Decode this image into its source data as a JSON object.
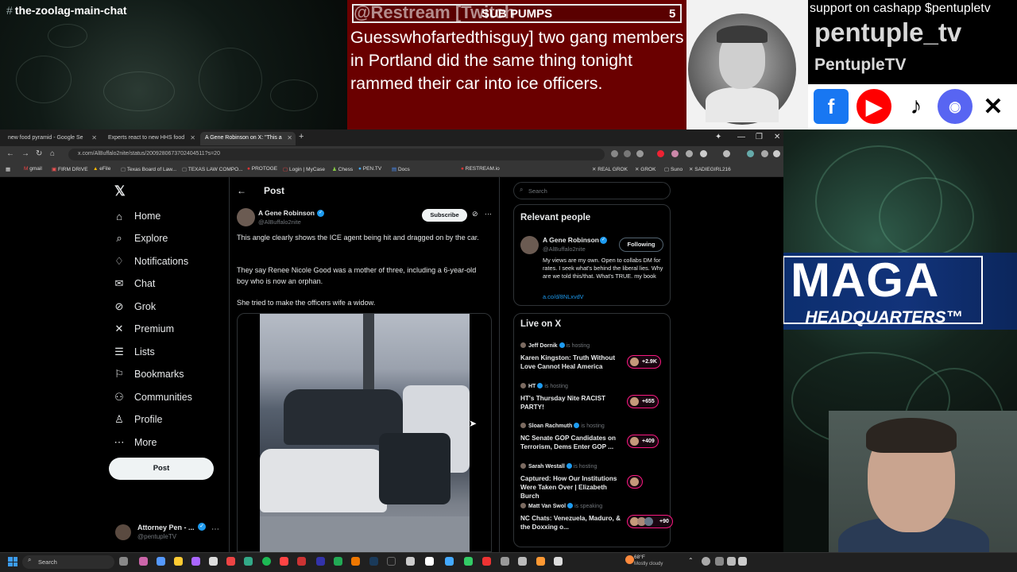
{
  "stream": {
    "chat_title": "the-zoolag-main-chat",
    "alert": {
      "sender": "@Restream [Twitch",
      "tag": "SUB PUMPS",
      "count": "5",
      "message": "Guesswhofartedthisguy] two gang members in Portland did the same thing tonight rammed their car into ice officers."
    },
    "support_text": "support on cashapp $pentupletv",
    "brand_handle": "pentuple_tv",
    "brand_name": "PentupleTV",
    "social_icons": [
      "facebook-icon",
      "youtube-icon",
      "tiktok-icon",
      "discord-icon",
      "x-icon"
    ],
    "banner_title": "MAGA",
    "banner_sub": "HEADQUARTERS™"
  },
  "browser": {
    "tabs": [
      {
        "label": "new food pyramid - Google Se",
        "active": false
      },
      {
        "label": "Experts react to new HHS food",
        "active": false
      },
      {
        "label": "A Gene Robinson on X: \"This a",
        "active": true
      }
    ],
    "url": "x.com/AlBuffalo2nite/status/2009280673702404511?s=20",
    "bookmarks": [
      "gmail",
      "FIRM DRIVE",
      "eFile",
      "Texas Board of Law...",
      "TEXAS LAW COMPO...",
      "PROTOGE",
      "Login | MyCase",
      "Chess",
      "PEN.TV",
      "Docs",
      "RESTREAM.io",
      "REAL GROK",
      "GROK",
      "Suno",
      "SADIEGIRL216"
    ]
  },
  "x": {
    "nav": [
      {
        "label": "Home",
        "icon": "home-icon",
        "glyph": "⌂"
      },
      {
        "label": "Explore",
        "icon": "search-icon",
        "glyph": "⌕"
      },
      {
        "label": "Notifications",
        "icon": "bell-icon",
        "glyph": "♢"
      },
      {
        "label": "Chat",
        "icon": "mail-icon",
        "glyph": "✉"
      },
      {
        "label": "Grok",
        "icon": "grok-icon",
        "glyph": "⊘"
      },
      {
        "label": "Premium",
        "icon": "x-logo-icon",
        "glyph": "✕"
      },
      {
        "label": "Lists",
        "icon": "list-icon",
        "glyph": "☰"
      },
      {
        "label": "Bookmarks",
        "icon": "bookmark-icon",
        "glyph": "⚐"
      },
      {
        "label": "Communities",
        "icon": "communities-icon",
        "glyph": "⚇"
      },
      {
        "label": "Profile",
        "icon": "profile-icon",
        "glyph": "♙"
      },
      {
        "label": "More",
        "icon": "more-icon",
        "glyph": "⋯"
      }
    ],
    "post_button": "Post",
    "account": {
      "name": "Attorney Pen - ...",
      "handle": "@pentupleTV"
    },
    "post": {
      "header": "Post",
      "author_name": "A Gene Robinson",
      "author_handle": "@AlBuffalo2nite",
      "subscribe_label": "Subscribe",
      "paragraphs": [
        "This angle clearly shows the ICE agent being hit and dragged on by the car.",
        "They say Renee Nicole Good was a mother of three, including a 6-year-old boy who is now an orphan.",
        "She tried to make the officers wife a widow."
      ]
    },
    "search_placeholder": "Search",
    "relevant_people": {
      "title": "Relevant people",
      "name": "A Gene Robinson",
      "handle": "@AlBuffalo2nite",
      "follow_label": "Following",
      "bio": "My views are my own. Open to collabs DM for rates. I seek what's behind the liberal lies. Why are we told this/that. What's TRUE. my book",
      "link": "a.co/d/8NLxvdV"
    },
    "live": {
      "title": "Live on X",
      "items": [
        {
          "host": "Jeff Dornik",
          "status": "is hosting",
          "verified": true,
          "title": "Karen Kingston: Truth Without Love Cannot Heal America",
          "badge": "+2.9K"
        },
        {
          "host": "HT",
          "status": "is hosting",
          "verified": true,
          "title": "HT's Thursday Nite RACIST PARTY!",
          "badge": "+655"
        },
        {
          "host": "Sloan Rachmuth",
          "status": "is hosting",
          "verified": true,
          "title": "NC Senate GOP Candidates on Terrorism, Dems Enter GOP ...",
          "badge": "+409"
        },
        {
          "host": "Sarah Westall",
          "status": "is hosting",
          "verified": true,
          "title": "Captured: How Our Institutions Were Taken Over | Elizabeth Burch",
          "badge": ""
        },
        {
          "host": "Matt Van Swol",
          "status": "is speaking",
          "verified": true,
          "title": "NC Chats: Venezuela, Maduro, & the Doxxing o...",
          "badge": "+90"
        }
      ]
    }
  },
  "taskbar": {
    "search_label": "Search",
    "weather_temp": "68°F",
    "weather_cond": "Mostly cloudy"
  }
}
